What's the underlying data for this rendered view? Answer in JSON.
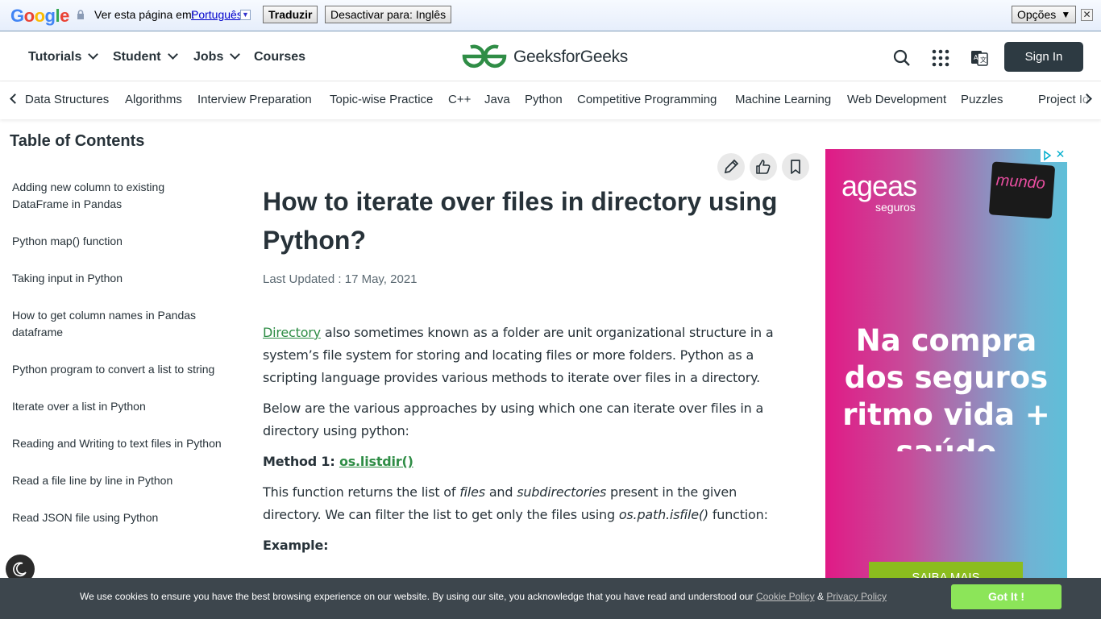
{
  "translate_bar": {
    "logo": "Google",
    "prompt": "Ver esta página em:",
    "language": "Português",
    "translate_label": "Traduzir",
    "disable_label": "Desactivar para: Inglês",
    "options_label": "Opções",
    "close_glyph": "✕",
    "logo_colors": [
      "#4285f4",
      "#ea4335",
      "#fbbc05",
      "#4285f4",
      "#34a853",
      "#ea4335"
    ]
  },
  "header": {
    "nav": [
      "Tutorials",
      "Student",
      "Jobs",
      "Courses"
    ],
    "logo_text": "GeeksforGeeks",
    "signin_label": "Sign In",
    "brand_color": "#2f8d46",
    "icons": [
      "search-icon",
      "apps-grid-icon",
      "translate-icon"
    ]
  },
  "topics": [
    "Data Structures",
    "Algorithms",
    "Interview Preparation",
    "Topic-wise Practice",
    "C++",
    "Java",
    "Python",
    "Competitive Programming",
    "Machine Learning",
    "Web Development",
    "Puzzles",
    "Project Ideas"
  ],
  "toc": {
    "title": "Table of Contents",
    "items": [
      "Adding new column to existing DataFrame in Pandas",
      "Python map() function",
      "Taking input in Python",
      "How to get column names in Pandas dataframe",
      "Python program to convert a list to string",
      "Iterate over a list in Python",
      "Reading and Writing to text files in Python",
      "Read a file line by line in Python",
      "Read JSON file using Python"
    ]
  },
  "article": {
    "title": "How to iterate over files in directory using Python?",
    "updated": "Last Updated : 17 May, 2021",
    "p1_link": "Directory",
    "p1_text": " also sometimes known as a folder are unit organizational structure in a system’s file system for storing and locating files or more folders. Python as a scripting language provides various methods to iterate over files in a directory.",
    "p2": "Below are the various approaches by using which one can iterate over files in a directory using python:",
    "method_label": "Method 1: ",
    "method_link": "os.listdir()",
    "p3_a": "This function returns the list of ",
    "p3_files": "files",
    "p3_b": " and ",
    "p3_subdirs": "subdirectories",
    "p3_c": " present in the given directory. We can filter the list to get only the files using ",
    "p3_func": "os.path.isfile()",
    "p3_d": " function:",
    "example_label": "Example:",
    "action_icons": [
      "edit-icon",
      "like-icon",
      "bookmark-icon"
    ]
  },
  "ad": {
    "brand": "ageas",
    "brand_sub": "seguros",
    "card_text": "mundo",
    "headline": "Na compra dos seguros ritmo vida + saúde",
    "cta": "SAIBA MAIS",
    "close_glyph": "✕"
  },
  "cookie": {
    "text": "We use cookies to ensure you have the best browsing experience on our website. By using our site, you acknowledge that you have read and understood our ",
    "policy1": "Cookie Policy",
    "amp": " & ",
    "policy2": "Privacy Policy",
    "button": "Got It !"
  }
}
